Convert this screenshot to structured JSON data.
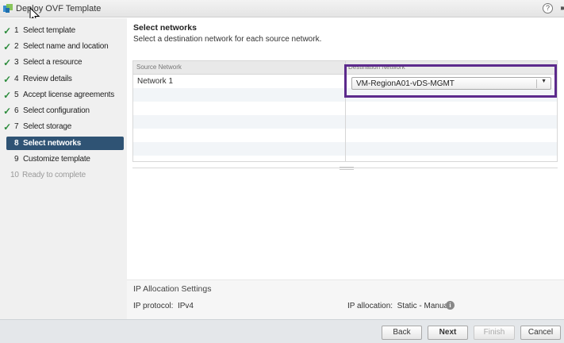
{
  "window": {
    "title": "Deploy OVF Template",
    "help_glyph": "?",
    "expand_glyph": "▸▸"
  },
  "steps": [
    {
      "number": "1",
      "label": "Select template",
      "state": "completed"
    },
    {
      "number": "2",
      "label": "Select name and location",
      "state": "completed"
    },
    {
      "number": "3",
      "label": "Select a resource",
      "state": "completed"
    },
    {
      "number": "4",
      "label": "Review details",
      "state": "completed"
    },
    {
      "number": "5",
      "label": "Accept license agreements",
      "state": "completed"
    },
    {
      "number": "6",
      "label": "Select configuration",
      "state": "completed"
    },
    {
      "number": "7",
      "label": "Select storage",
      "state": "completed"
    },
    {
      "number": "8",
      "label": "Select networks",
      "state": "active"
    },
    {
      "number": "9",
      "label": "Customize template",
      "state": "pending"
    },
    {
      "number": "10",
      "label": "Ready to complete",
      "state": "disabled"
    }
  ],
  "check_glyph": "✓",
  "main": {
    "title": "Select networks",
    "subtitle": "Select a destination network for each source network.",
    "table": {
      "col_source": "Source Network",
      "col_destination": "Destination Network",
      "rows": [
        {
          "source": "Network 1",
          "destination": "VM-RegionA01-vDS-MGMT"
        }
      ]
    },
    "dropdown_arrow": "▼"
  },
  "ip_settings": {
    "title": "IP Allocation Settings",
    "protocol_label": "IP protocol:",
    "protocol_value": "IPv4",
    "allocation_label": "IP allocation:",
    "allocation_value": "Static - Manual",
    "info_glyph": "i"
  },
  "footer": {
    "back": "Back",
    "next": "Next",
    "finish": "Finish",
    "cancel": "Cancel"
  },
  "colors": {
    "active_step_bg": "#2f5374",
    "highlight_border": "#5c2a8c",
    "check": "#2c8c3c"
  }
}
